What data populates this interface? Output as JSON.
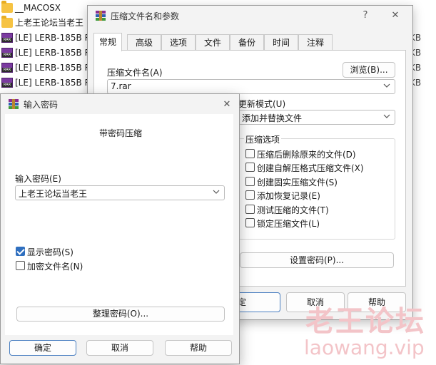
{
  "background_files": {
    "items": [
      {
        "icon": "folder-icon",
        "name": "__MACOSX",
        "size": ""
      },
      {
        "icon": "folder-icon",
        "name": "上老王论坛当老王",
        "size": ""
      },
      {
        "icon": "rar-file-icon",
        "name": "[LE] LERB-185B R",
        "size": "KB"
      },
      {
        "icon": "rar-file-icon",
        "name": "[LE] LERB-185B R",
        "size": "KB"
      },
      {
        "icon": "rar-file-icon",
        "name": "[LE] LERB-185B R",
        "size": "KB"
      },
      {
        "icon": "rar-file-icon",
        "name": "[LE] LERB-185B R",
        "size": "KB"
      }
    ]
  },
  "main_dialog": {
    "title": "压缩文件名和参数",
    "help_glyph": "?",
    "close_glyph": "✕",
    "tabs": [
      "常规",
      "高级",
      "选项",
      "文件",
      "备份",
      "时间",
      "注释"
    ],
    "active_tab": "常规",
    "archive_name_label": "压缩文件名(A)",
    "browse_button": "浏览(B)...",
    "archive_name_value": "7.rar",
    "update_mode_label": "更新模式(U)",
    "update_mode_value": "添加并替换文件",
    "options_group_label": "压缩选项",
    "options": [
      {
        "label": "压缩后删除原来的文件(D)",
        "checked": false
      },
      {
        "label": "创建自解压格式压缩文件(X)",
        "checked": false
      },
      {
        "label": "创建固实压缩文件(S)",
        "checked": false
      },
      {
        "label": "添加恢复记录(E)",
        "checked": false
      },
      {
        "label": "测试压缩的文件(T)",
        "checked": false
      },
      {
        "label": "锁定压缩文件(L)",
        "checked": false
      }
    ],
    "set_password_button": "设置密码(P)...",
    "ok_button": "确定",
    "cancel_button": "取消",
    "help_button": "帮助"
  },
  "password_dialog": {
    "title": "输入密码",
    "close_glyph": "✕",
    "heading": "带密码压缩",
    "password_label": "输入密码(E)",
    "password_value": "上老王论坛当老王",
    "show_password_label": "显示密码(S)",
    "show_password_checked": true,
    "encrypt_names_label": "加密文件名(N)",
    "encrypt_names_checked": false,
    "organize_button": "整理密码(O)...",
    "ok_button": "确定",
    "cancel_button": "取消",
    "help_button": "帮助"
  },
  "watermark": {
    "line1": "老王论坛",
    "line2": "laowang.vip",
    "color": "#f3c4c8"
  }
}
